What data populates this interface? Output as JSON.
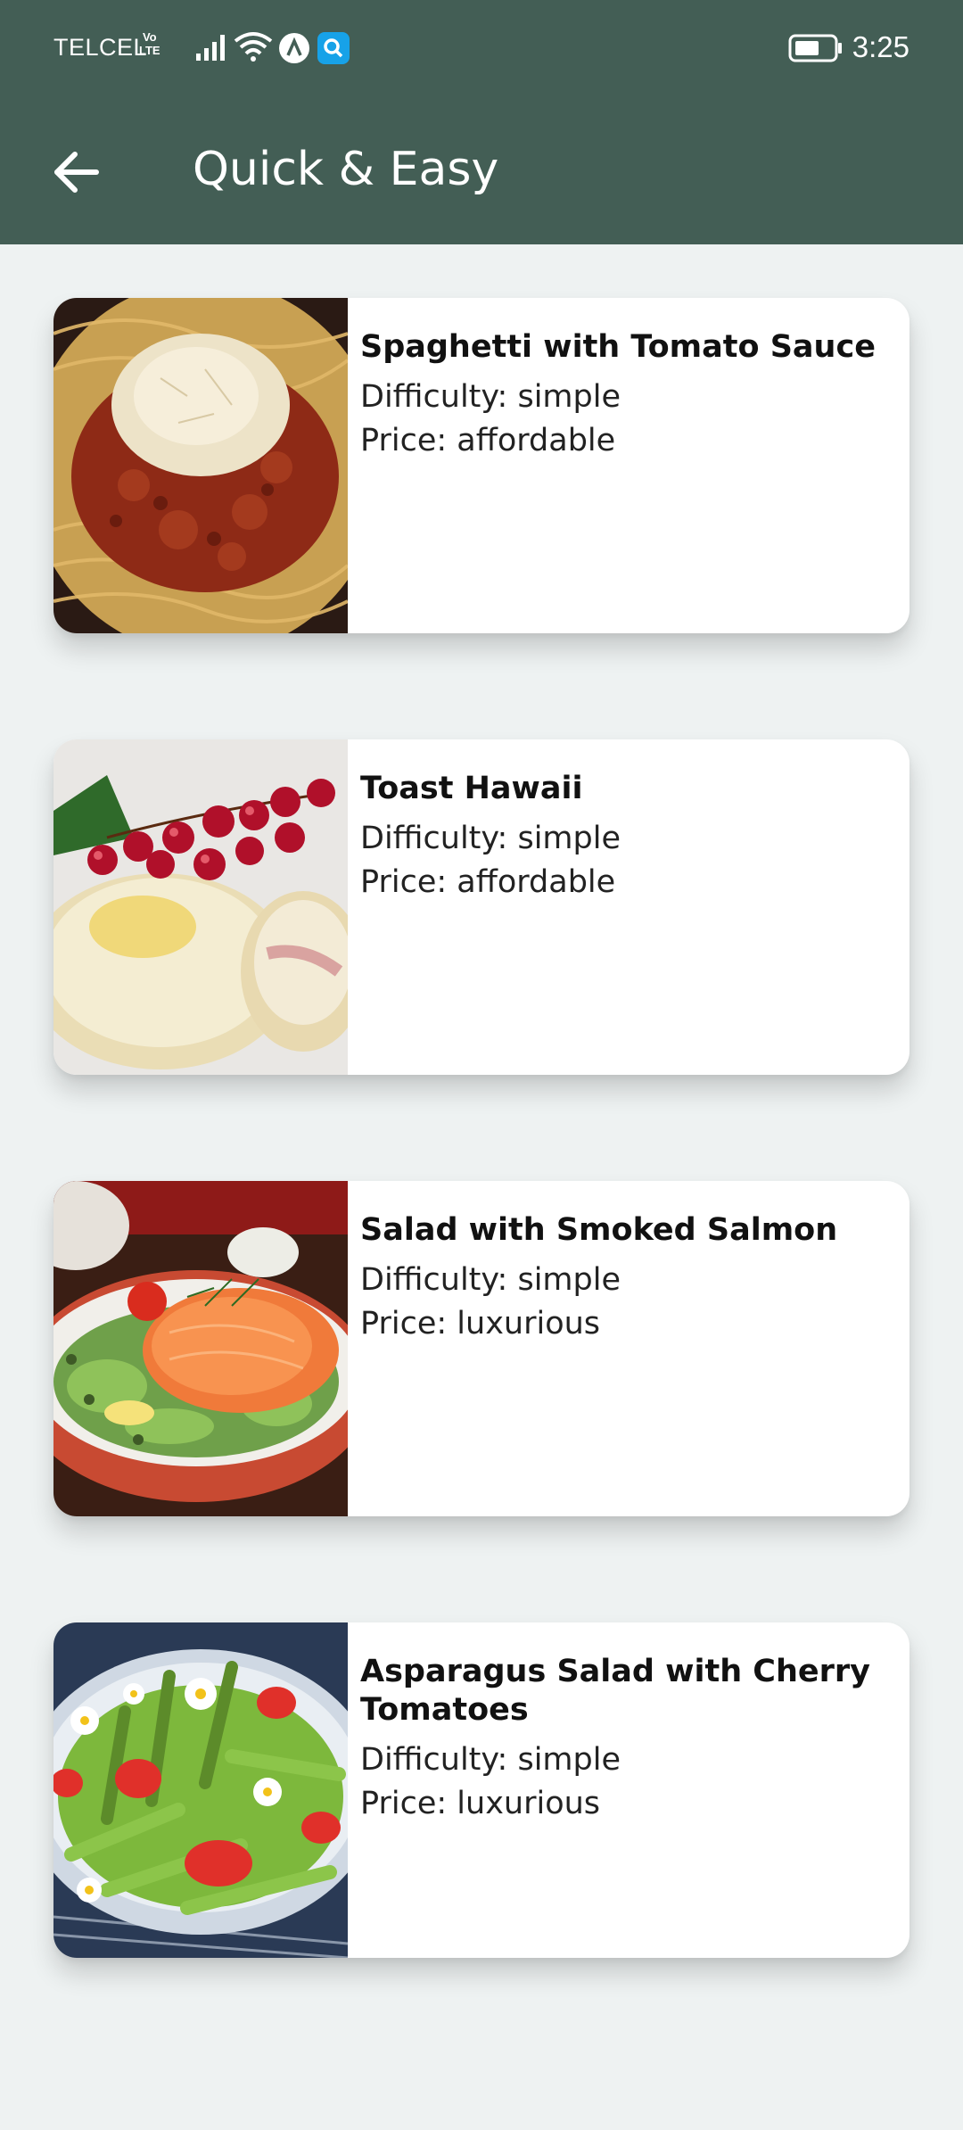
{
  "status": {
    "carrier": "TELCEL",
    "volte_top": "Vo",
    "volte_bottom": "LTE",
    "time": "3:25",
    "icons": [
      "signal-icon",
      "wifi-icon",
      "app-a-icon",
      "search-app-icon",
      "battery-icon"
    ]
  },
  "appbar": {
    "back_icon": "arrow-back-icon",
    "title": "Quick & Easy"
  },
  "meals": [
    {
      "title": "Spaghetti with Tomato Sauce",
      "difficulty": "Difficulty: simple",
      "price": "Price: affordable"
    },
    {
      "title": "Toast Hawaii",
      "difficulty": "Difficulty: simple",
      "price": "Price: affordable"
    },
    {
      "title": "Salad with Smoked Salmon",
      "difficulty": "Difficulty: simple",
      "price": "Price: luxurious"
    },
    {
      "title": "Asparagus Salad with Cherry Tomatoes",
      "difficulty": "Difficulty: simple",
      "price": "Price: luxurious"
    }
  ],
  "colors": {
    "appbar": "#435E55",
    "background": "#EEF2F2",
    "card": "#FFFFFF"
  }
}
